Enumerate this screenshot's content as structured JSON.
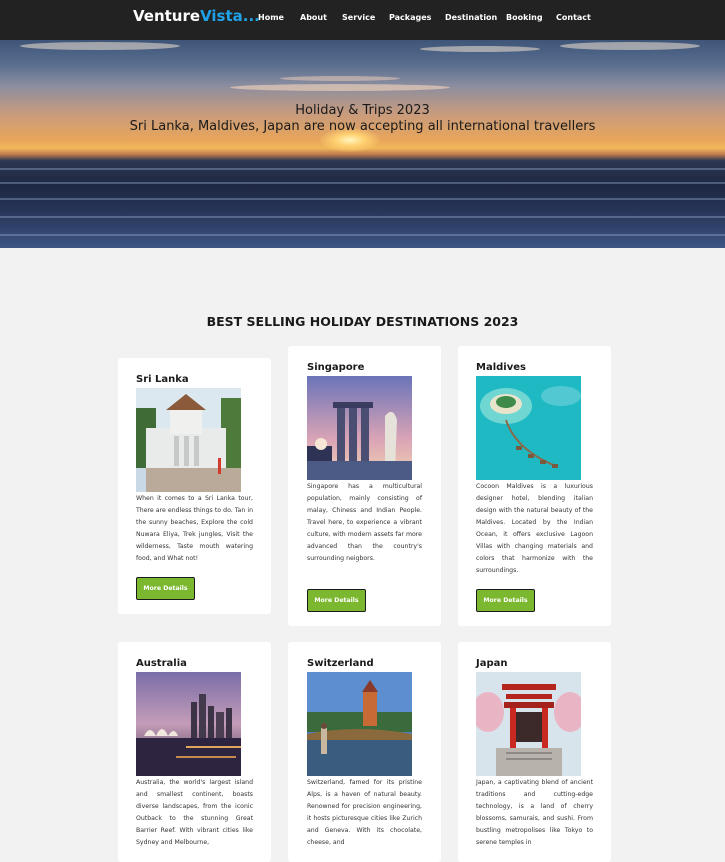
{
  "nav": {
    "logo_main": "Venture",
    "logo_accent": "Vista...",
    "links": [
      "Home",
      "About",
      "Service",
      "Packages",
      "Destination",
      "Booking",
      "Contact"
    ]
  },
  "hero": {
    "title": "Holiday & Trips 2023",
    "subtitle": "Sri Lanka, Maldives, Japan are now accepting all international travellers"
  },
  "section": {
    "title": "BEST SELLING HOLIDAY DESTINATIONS 2023"
  },
  "button_label": "More Details",
  "colors": {
    "nav_bg": "#222222",
    "logo_accent": "#1fa3e8",
    "button_bg": "#7cb82f",
    "page_bg": "#f2f2f2"
  },
  "destinations": [
    {
      "name": "Sri Lanka",
      "image": "temple-image",
      "description": "When it comes to a Sri Lanka tour, There are endless things to do. Tan in the sunny beaches, Explore the cold Nuwara Eliya, Trek jungles, Visit the wilderness, Taste mouth watering food, and What not!"
    },
    {
      "name": "Singapore",
      "image": "marina-bay-image",
      "description": "Singapore has a multicultural population, mainly consisting of malay, Chiness and Indian People. Travel here, to experience a vibrant culture, with modern assets far more advanced than the country's surrounding neigbors."
    },
    {
      "name": "Maldives",
      "image": "water-villas-image",
      "description": "Cocoon Maldives is a luxurious designer hotel, blending italian design with the natural beauty of the Maldives. Located by the Indian Ocean, it offers exclusive Lagoon Villas with changing materials and colors that harmonize with the surroundings."
    },
    {
      "name": "Australia",
      "image": "sydney-harbour-image",
      "description": "Australia, the world's largest island and smallest continent, boasts diverse landscapes, from the iconic Outback to the stunning Great Barrier Reef. With vibrant cities like Sydney and Melbourne,"
    },
    {
      "name": "Switzerland",
      "image": "lucerne-bridge-image",
      "description": "Switzerland, famed for its pristine Alps, is a haven of natural beauty. Renowned for precision engineering, it hosts picturesque cities like Zurich and Geneva. With its chocolate, cheese, and"
    },
    {
      "name": "Japan",
      "image": "red-shrine-image",
      "description": "Japan, a captivating blend of ancient traditions and cutting-edge technology, is a land of cherry blossoms, samurais, and sushi. From bustling metropolises like Tokyo to serene temples in"
    }
  ]
}
